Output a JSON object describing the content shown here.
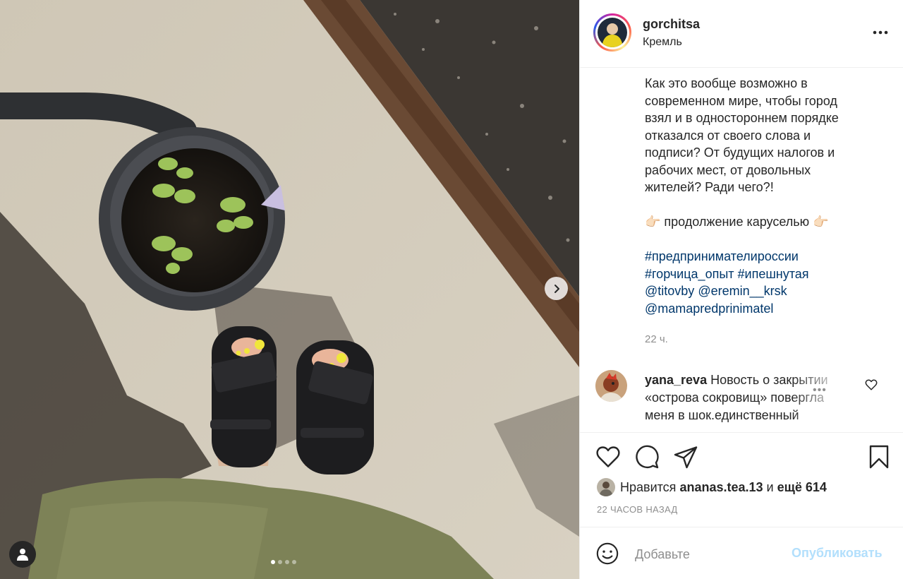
{
  "post": {
    "username": "gorchitsa",
    "location": "Кремль",
    "caption_text": "Как это вообще возможно в\nсовременном мире, чтобы город\nвзял и в одностороннем порядке\nотказался от своего слова и\nподписи? От будущих налогов и\nрабочих мест, от довольных\nжителей? Ради чего?!",
    "carousel_note": "👉🏻 продолжение каруселью 👉🏻",
    "hashtags": [
      "#предпринимателироссии",
      "#горчица_опыт",
      "#ипешнутая"
    ],
    "mentions": [
      "@titovby",
      "@eremin__krsk",
      "@mamapredprinimatel"
    ],
    "time_short": "22 ч."
  },
  "comment": {
    "username": "yana_reva",
    "text": "Новость о закрытии «острова сокровищ» повергла меня в шок.единственный",
    "more_label": "•••"
  },
  "likes": {
    "prefix": "Нравится",
    "liker": "ananas.tea.13",
    "conjunction": "и",
    "others": "ещё 614"
  },
  "time_ago": "22 ЧАСОВ НАЗАД",
  "add_comment": {
    "placeholder": "Добавьте",
    "post_label": "Опубликовать"
  },
  "carousel": {
    "slide_count": 4,
    "active_index": 0
  },
  "colors": {
    "link": "#00376b",
    "muted": "#8e8e8e",
    "post_button_disabled": "#b2dffc"
  },
  "icons": [
    "chevron-right-icon",
    "user-tag-icon",
    "more-options-icon",
    "heart-icon",
    "comment-icon",
    "share-icon",
    "bookmark-icon",
    "emoji-icon"
  ]
}
